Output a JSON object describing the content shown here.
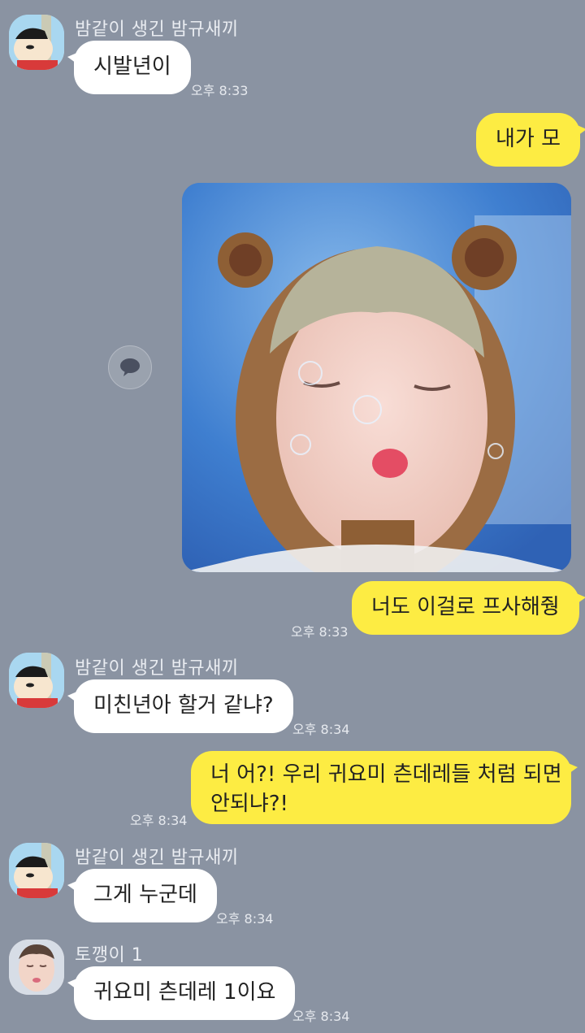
{
  "messages": [
    {
      "sender": "밤같이 생긴 밤규새끼",
      "text": "시발년이",
      "time": "오후 8:33"
    },
    {
      "text": "내가 모"
    },
    {
      "text": "너도 이걸로 프사해줭",
      "time": "오후 8:33"
    },
    {
      "sender": "밤같이 생긴 밤규새끼",
      "text": "미친년아 할거 같냐?",
      "time": "오후 8:34"
    },
    {
      "text_line1": "너 어?! 우리 귀요미 츤데레들 처럼 되면",
      "text_line2": "안되냐?!",
      "time": "오후 8:34"
    },
    {
      "sender": "밤같이 생긴 밤규새끼",
      "text": "그게 누군데",
      "time": "오후 8:34"
    },
    {
      "sender": "토깽이 1",
      "text": "귀요미 츤데레 1이요",
      "time": "오후 8:34"
    }
  ],
  "icons": {
    "share": "speech-bubble-share-icon"
  },
  "colors": {
    "background": "#8a93a2",
    "outgoing_bubble": "#fdec43",
    "incoming_bubble": "#ffffff"
  }
}
